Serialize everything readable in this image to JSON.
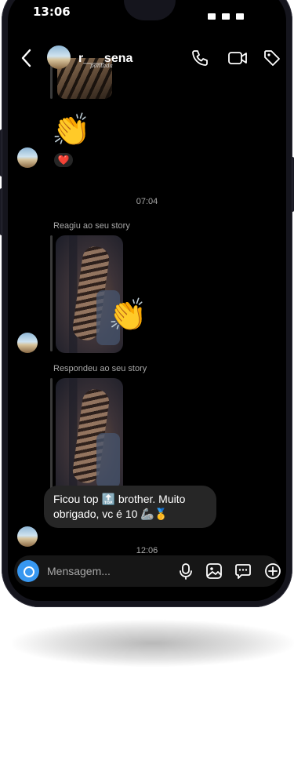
{
  "status_bar": {
    "time": "13:06"
  },
  "header": {
    "username": "r___sena"
  },
  "icons": {
    "back": "chevron-left-icon",
    "call": "phone-icon",
    "video": "video-camera-icon",
    "tag": "tag-icon",
    "mic": "microphone-icon",
    "gallery": "image-icon",
    "sticker": "chat-bubble-icon",
    "add": "plus-circle-icon"
  },
  "colors": {
    "background": "#000000",
    "bubble": "#262626",
    "accent": "#3797f0",
    "meta_text": "#a8a8a8"
  },
  "messages": {
    "tiger_caption": "pontada",
    "clap_emoji": "👏",
    "heart_reaction": "❤️",
    "timestamp_1": "07:04",
    "story_reaction_label": "Reagiu ao seu story",
    "story_reaction_emoji": "👏",
    "story_reply_label": "Respondeu ao seu story",
    "reply_text_1": "Ficou top",
    "reply_badge": "🔝",
    "reply_text_2": "brother. Muito obrigado, vc é 10 🦾🥇",
    "timestamp_2": "12:06"
  },
  "composer": {
    "placeholder": "Mensagem..."
  }
}
